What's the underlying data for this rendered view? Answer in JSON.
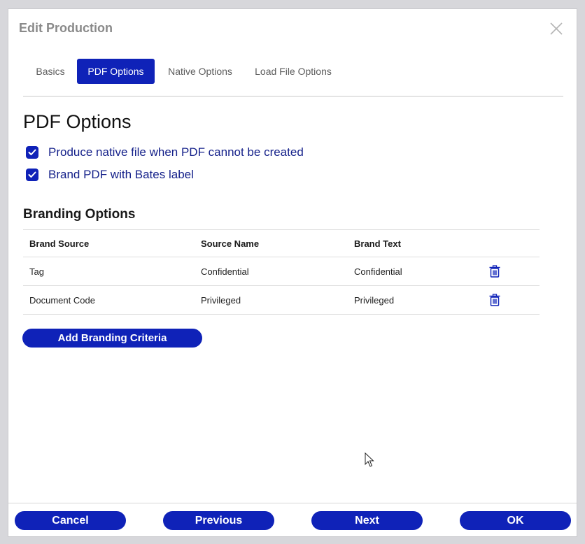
{
  "dialog": {
    "title": "Edit Production"
  },
  "tabs": [
    {
      "label": "Basics",
      "active": false
    },
    {
      "label": "PDF Options",
      "active": true
    },
    {
      "label": "Native Options",
      "active": false
    },
    {
      "label": "Load File Options",
      "active": false
    }
  ],
  "pdf_options": {
    "heading": "PDF Options",
    "checkboxes": [
      {
        "label": "Produce native file when PDF cannot be created",
        "checked": true
      },
      {
        "label": "Brand PDF with Bates label",
        "checked": true
      }
    ]
  },
  "branding": {
    "heading": "Branding Options",
    "columns": [
      "Brand Source",
      "Source Name",
      "Brand Text"
    ],
    "rows": [
      {
        "source": "Tag",
        "name": "Confidential",
        "text": "Confidential"
      },
      {
        "source": "Document Code",
        "name": "Privileged",
        "text": "Privileged"
      }
    ],
    "add_label": "Add Branding Criteria"
  },
  "footer": {
    "cancel": "Cancel",
    "previous": "Previous",
    "next": "Next",
    "ok": "OK"
  },
  "colors": {
    "accent": "#0f22b8",
    "label_blue": "#15218a"
  },
  "icons": {
    "close": "close-icon",
    "check": "check-icon",
    "trash": "trash-icon"
  }
}
